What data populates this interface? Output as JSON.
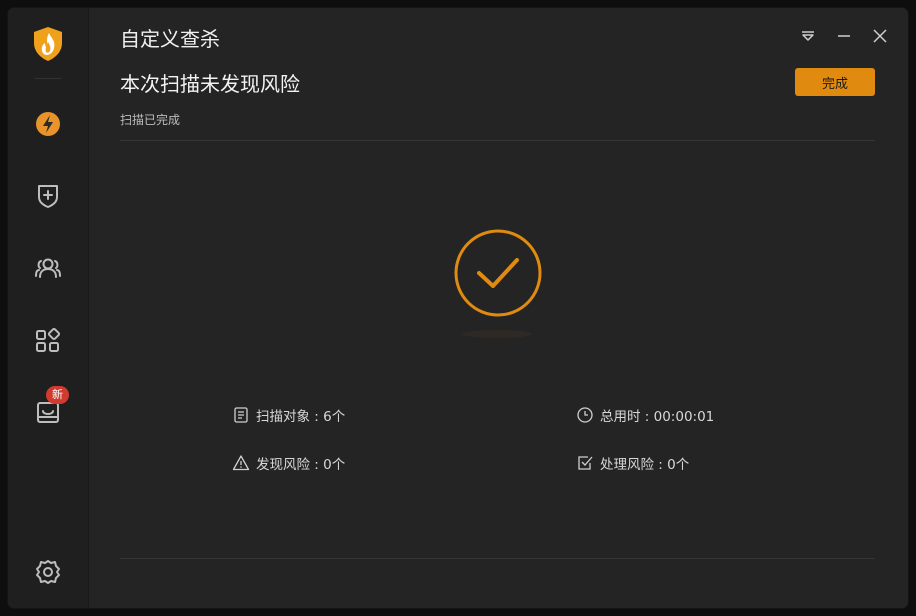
{
  "window": {
    "title": "自定义查杀",
    "controls": {
      "menu_icon": "dropdown-menu-icon",
      "minimize_icon": "minimize-icon",
      "close_icon": "close-icon"
    }
  },
  "sidebar": {
    "logo_icon": "shield-flame-logo",
    "items": [
      {
        "icon": "lightning-boost-icon"
      },
      {
        "icon": "shield-plus-icon"
      },
      {
        "icon": "users-icon"
      },
      {
        "icon": "apps-grid-icon"
      },
      {
        "icon": "toolbox-icon",
        "badge": "新"
      },
      {
        "icon": "settings-gear-icon"
      }
    ]
  },
  "result": {
    "title": "本次扫描未发现风险",
    "done_label": "完成",
    "status": "扫描已完成"
  },
  "stats": {
    "scan_objects": "扫描对象 : 6个",
    "total_time": "总用时 : 00:00:01",
    "found_risks": "发现风险 : 0个",
    "handled_risks": "处理风险 : 0个"
  },
  "colors": {
    "accent": "#e08b10",
    "background": "#242424",
    "sidebar": "#1f1f1f",
    "badge": "#d13b2f"
  }
}
